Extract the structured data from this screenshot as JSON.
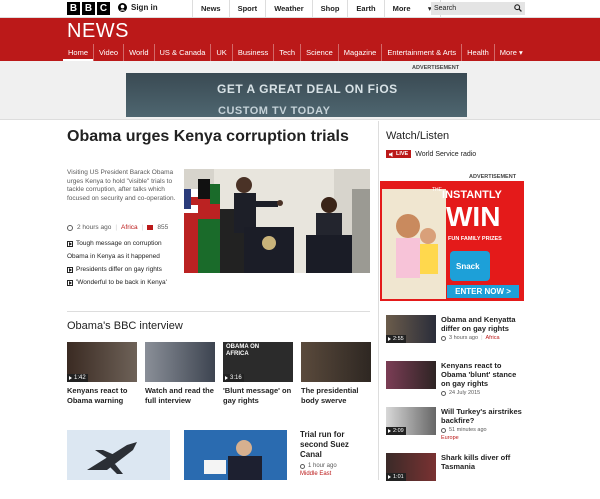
{
  "topbar": {
    "logo": [
      "B",
      "B",
      "C"
    ],
    "signin": "Sign in",
    "nav": [
      "News",
      "Sport",
      "Weather",
      "Shop",
      "Earth"
    ],
    "more": "More",
    "search_placeholder": "Search"
  },
  "header": {
    "title": "NEWS",
    "nav": [
      "Home",
      "Video",
      "World",
      "US & Canada",
      "UK",
      "Business",
      "Tech",
      "Science",
      "Magazine",
      "Entertainment & Arts",
      "Health",
      "More ▾"
    ],
    "active": "Home"
  },
  "ad_top": {
    "label": "ADVERTISEMENT",
    "line1": "GET A GREAT DEAL ON FiOS",
    "line2": "CUSTOM TV TODAY"
  },
  "main_story": {
    "title": "Obama urges Kenya corruption trials",
    "summary": "Visiting US President Barack Obama urges Kenya to hold \"visible\" trials to tackle corruption, after talks which focused on security and co-operation.",
    "time": "2 hours ago",
    "section": "Africa",
    "comments": "855",
    "related": [
      "Tough message on corruption",
      "Obama in Kenya as it happened",
      "Presidents differ on gay rights",
      "'Wonderful to be back in Kenya'"
    ]
  },
  "watch": {
    "title": "Watch/Listen",
    "live": "LIVE",
    "radio": "World Service radio"
  },
  "ad_side": {
    "label": "ADVERTISEMENT",
    "the": "THE",
    "instantly": "INSTANTLY",
    "win": "WIN",
    "fun": "FUN FAMILY PRIZES",
    "enter": "ENTER NOW >"
  },
  "interview": {
    "heading": "Obama's BBC interview",
    "cards": [
      {
        "duration": "1:42",
        "caption": "Kenyans react to Obama warning"
      },
      {
        "duration": "",
        "caption": "Watch and read the full interview"
      },
      {
        "duration": "3:16",
        "caption": "'Blunt message' on gay rights"
      },
      {
        "duration": "",
        "caption": "The presidential body swerve"
      }
    ],
    "overlay": "OBAMA ON AFRICA"
  },
  "bottom_story": {
    "title": "Trial run for second Suez Canal",
    "time": "1 hour ago",
    "section": "Middle East"
  },
  "right_list": [
    {
      "duration": "2:55",
      "title": "Obama and Kenyatta differ on gay rights",
      "time": "3 hours ago",
      "section": "Africa"
    },
    {
      "duration": "",
      "title": "Kenyans react to Obama 'blunt' stance on gay rights",
      "time": "24 July 2015",
      "section": ""
    },
    {
      "duration": "2:09",
      "title": "Will Turkey's airstrikes backfire?",
      "time": "51 minutes ago",
      "section": "Europe"
    },
    {
      "duration": "1:01",
      "title": "Shark kills diver off Tasmania",
      "time": "",
      "section": ""
    }
  ]
}
